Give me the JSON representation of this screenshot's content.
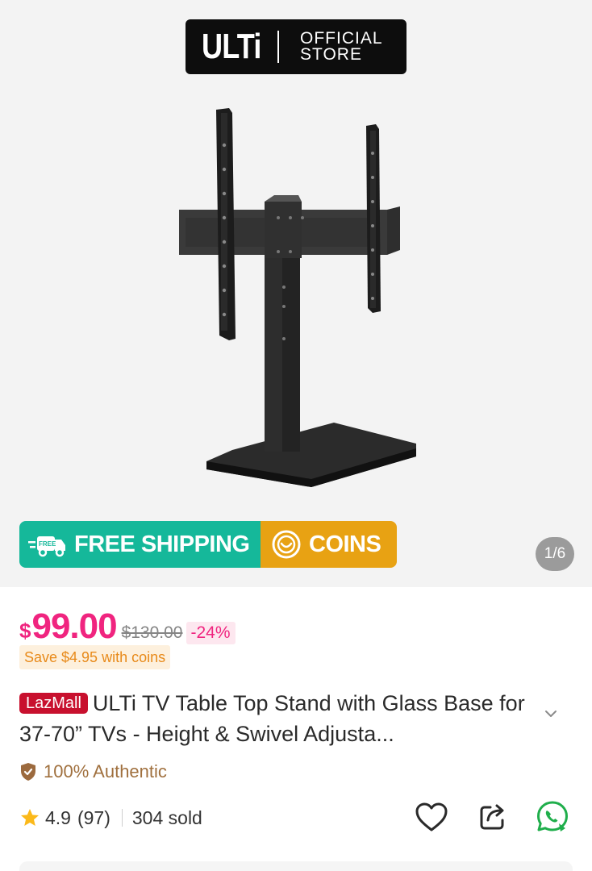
{
  "store": {
    "logo": "ULTi",
    "line1": "OFFICIAL",
    "line2": "STORE"
  },
  "banner": {
    "shipping_label": "FREE SHIPPING",
    "free_badge": "FREE",
    "coins_label": "COINS"
  },
  "gallery": {
    "counter": "1/6"
  },
  "price": {
    "currency": "$",
    "current": "99.00",
    "original": "$130.00",
    "discount": "-24%"
  },
  "coins_save": "Save $4.95 with coins",
  "product": {
    "badge": "LazMall",
    "title": "ULTi TV Table Top Stand with Glass Base for 37-70” TVs - Height & Swivel Adjusta..."
  },
  "authentic": "100% Authentic",
  "rating": {
    "value": "4.9",
    "count": "(97)",
    "sold": "304 sold"
  },
  "colors": {
    "accent_pink": "#f0247f",
    "shipping_green": "#15b89a",
    "coins_orange": "#e8a213",
    "lazmall_red": "#c8102e",
    "whatsapp_green": "#1fae4b"
  }
}
